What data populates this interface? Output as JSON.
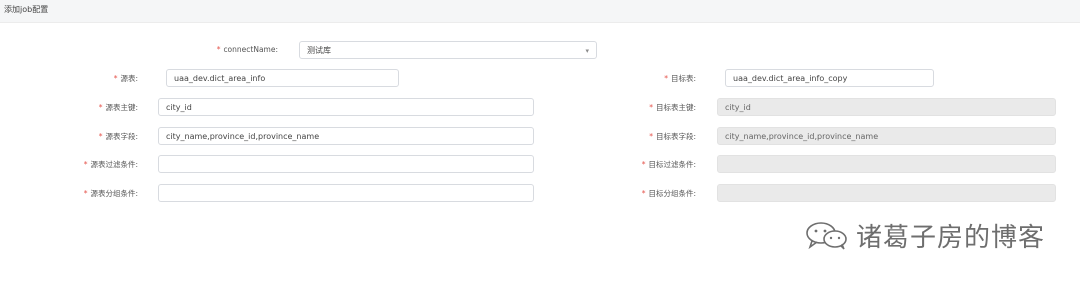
{
  "header": {
    "title": "添加job配置"
  },
  "connect": {
    "label": "connectName:",
    "value": "测试库"
  },
  "source": {
    "table_label": "源表:",
    "table_value": "uaa_dev.dict_area_info",
    "pk_label": "源表主键:",
    "pk_value": "city_id",
    "fields_label": "源表字段:",
    "fields_value": "city_name,province_id,province_name",
    "filter_label": "源表过滤条件:",
    "filter_value": "",
    "group_label": "源表分组条件:",
    "group_value": ""
  },
  "target": {
    "table_label": "目标表:",
    "table_value": "uaa_dev.dict_area_info_copy",
    "pk_label": "目标表主键:",
    "pk_value": "city_id",
    "fields_label": "目标表字段:",
    "fields_value": "city_name,province_id,province_name",
    "filter_label": "目标过滤条件:",
    "filter_value": "",
    "group_label": "目标分组条件:",
    "group_value": ""
  },
  "required_mark": "*",
  "watermark": {
    "text": "诸葛子房的博客",
    "icon": "wechat-icon"
  },
  "colors": {
    "required": "#e5534b",
    "disabled_bg": "#eaeaea",
    "border": "#d8dbe0"
  }
}
